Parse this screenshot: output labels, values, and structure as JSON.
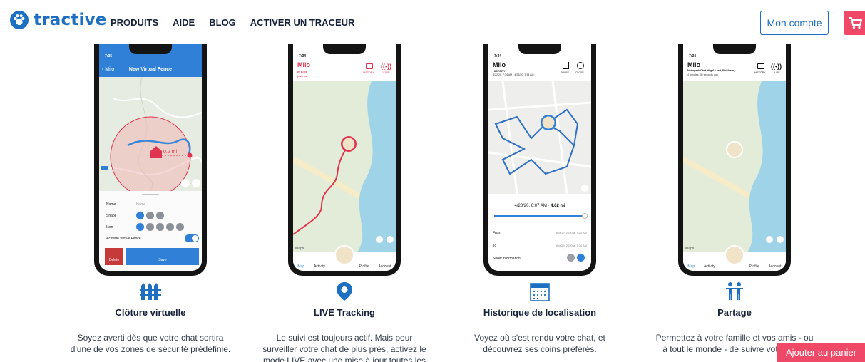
{
  "header": {
    "brand": "tractive",
    "nav": [
      "PRODUITS",
      "AIDE",
      "BLOG",
      "ACTIVER UN TRACEUR"
    ],
    "account_label": "Mon compte",
    "cart_icon": "shopping-cart-icon"
  },
  "colors": {
    "brand_blue": "#1d6fc2",
    "cart_pink": "#ef4967",
    "live_red": "#e0334f"
  },
  "features": [
    {
      "icon": "fence-icon",
      "title": "Clôture virtuelle",
      "desc_line1": "Soyez averti dès que votre chat sortira",
      "desc_line2": "d'une de vos zones de sécurité prédéfinie.",
      "screen": {
        "time": "7:35",
        "back": "Milo",
        "header": "New Virtual Fence",
        "distance": "0.2 mi",
        "name_label": "Name",
        "name_placeholder": "Home",
        "shape_label": "Shape",
        "icon_label": "Icon",
        "activate_label": "Activate Virtual Fence",
        "delete_label": "Delete",
        "save_label": "Save"
      }
    },
    {
      "icon": "location-pin-icon",
      "title": "LIVE Tracking",
      "desc_line1": "Le suivi est toujours actif. Mais pour",
      "desc_line2": "surveiller votre chat de plus près, activez le",
      "desc_line3": "mode LIVE avec une mise à jour toutes les",
      "screen": {
        "time": "7:34",
        "pet": "Milo",
        "status": "IN LIVE",
        "sub": "just now",
        "history": "HISTORY",
        "stop": "STOP",
        "maps": "Maps",
        "tabs": [
          "Map",
          "Activity",
          "Profile",
          "Account"
        ]
      }
    },
    {
      "icon": "calendar-icon",
      "title": "Historique de localisation",
      "desc_line1": "Voyez où s'est rendu votre chat, et",
      "desc_line2": "découvrez ses coins préférés.",
      "screen": {
        "time": "7:34",
        "pet": "Milo",
        "label": "HISTORY",
        "range": "4/22/20, 7:34 AM  -  4/23/20, 7:34 AM",
        "share": "SHARE",
        "close": "CLOSE",
        "summary_date": "4/23/20, 6:07 AM",
        "summary_dist": "4.62 mi",
        "from_label": "From",
        "from_value": "Apr 22, 2020 at 7:34 AM",
        "to_label": "To",
        "to_value": "Apr 23, 2020 at 7:34 AM",
        "show_info": "Show information"
      }
    },
    {
      "icon": "people-icon",
      "title": "Partage",
      "desc_line1": "Permettez à votre famille et vos amis - ou",
      "desc_line2": "à tout le monde - de suivre votre chat.",
      "screen": {
        "time": "7:34",
        "pet": "Milo",
        "place": "Naturpark Obst-Hügel-Land, Finklham, ...",
        "ago": "4 minutes, 30 seconds ago",
        "history": "HISTORY",
        "live": "LIVE",
        "maps": "Maps",
        "tabs": [
          "Map",
          "Activity",
          "Profile",
          "Account"
        ]
      }
    }
  ],
  "cta": {
    "add_to_cart": "Ajouter au panier"
  }
}
